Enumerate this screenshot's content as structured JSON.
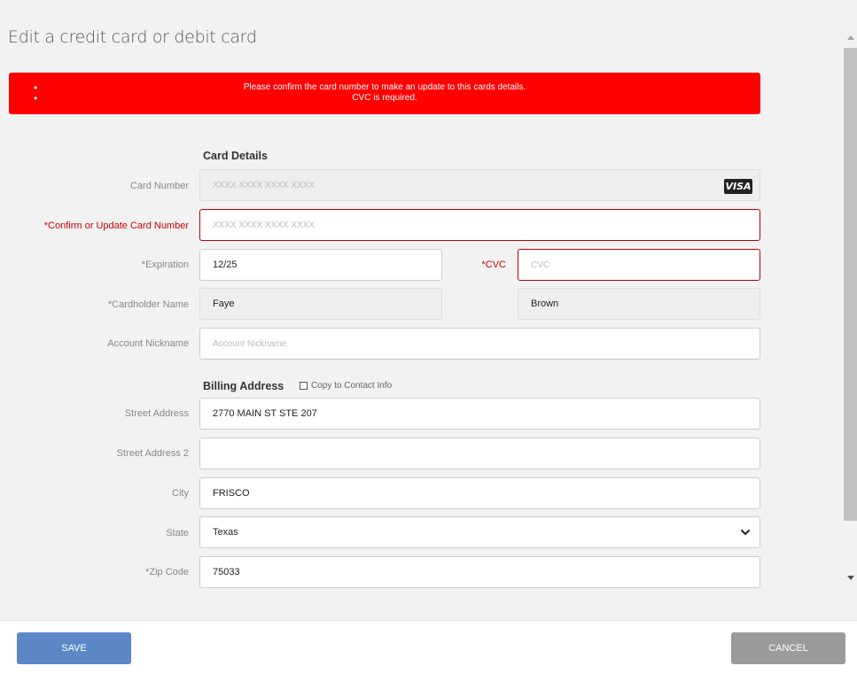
{
  "title": "Edit a credit card or debit card",
  "errors": [
    "Please confirm the card number to make an update to this cards details.",
    "CVC is required."
  ],
  "card_details": {
    "heading": "Card Details",
    "card_number": {
      "label": "Card Number",
      "placeholder": "XXXX XXXX XXXX XXXX",
      "brand": "VISA"
    },
    "confirm_number": {
      "label": "*Confirm or Update Card Number",
      "placeholder": "XXXX XXXX XXXX XXXX"
    },
    "expiration": {
      "label": "*Expiration",
      "value": "12/25"
    },
    "cvc": {
      "label": "*CVC",
      "placeholder": "CVC"
    },
    "cardholder": {
      "label": "*Cardholder Name",
      "first": "Faye",
      "last": "Brown"
    },
    "nickname": {
      "label": "Account Nickname",
      "placeholder": "Account Nickname"
    }
  },
  "billing": {
    "heading": "Billing Address",
    "copy_label": "Copy to Contact Info",
    "street": {
      "label": "Street Address",
      "value": "2770 MAIN ST STE 207"
    },
    "street2": {
      "label": "Street Address 2",
      "value": ""
    },
    "city": {
      "label": "City",
      "value": "FRISCO"
    },
    "state": {
      "label": "State",
      "value": "Texas"
    },
    "zip": {
      "label": "*Zip Code",
      "value": "75033"
    }
  },
  "buttons": {
    "save": "SAVE",
    "cancel": "CANCEL"
  },
  "colors": {
    "error": "#ff0000",
    "save": "#5b87c7",
    "cancel": "#9b9b9b"
  }
}
